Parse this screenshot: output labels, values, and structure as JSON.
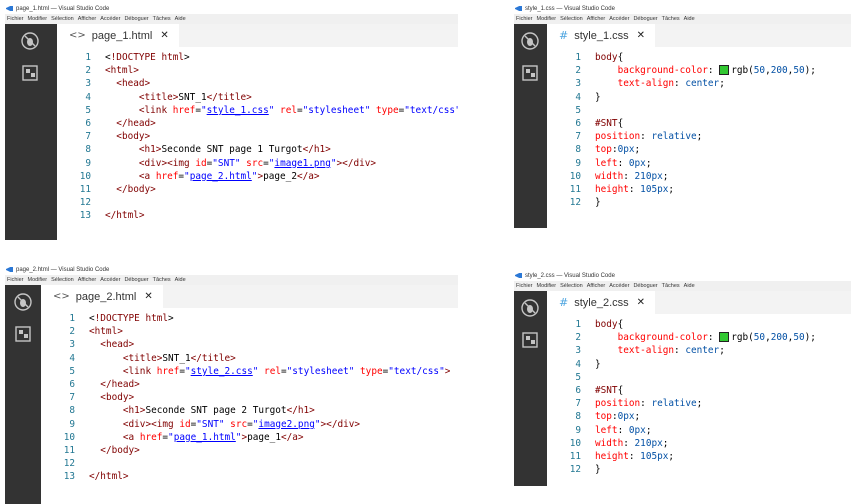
{
  "menu": [
    "Fichier",
    "Modifier",
    "Sélection",
    "Afficher",
    "Accéder",
    "Déboguer",
    "Tâches",
    "Aide"
  ],
  "windows": [
    {
      "id": "w1",
      "title": "page_1.html — Visual Studio Code",
      "tab": "page_1.html",
      "lines": [
        [
          {
            "c": "pun",
            "t": "<"
          },
          {
            "c": "tag",
            "t": "!DOCTYPE html"
          },
          {
            "c": "pun",
            "t": ">"
          }
        ],
        [
          {
            "c": "tag",
            "t": "<html>"
          }
        ],
        [
          {
            "c": "txt",
            "t": "  "
          },
          {
            "c": "tag",
            "t": "<head>"
          }
        ],
        [
          {
            "c": "txt",
            "t": "      "
          },
          {
            "c": "tag",
            "t": "<title>"
          },
          {
            "c": "txt",
            "t": "SNT_1"
          },
          {
            "c": "tag",
            "t": "</title>"
          }
        ],
        [
          {
            "c": "txt",
            "t": "      "
          },
          {
            "c": "tag",
            "t": "<link "
          },
          {
            "c": "attr",
            "t": "href"
          },
          {
            "c": "pun",
            "t": "="
          },
          {
            "c": "str",
            "t": "\""
          },
          {
            "c": "lnk",
            "t": "style_1.css"
          },
          {
            "c": "str",
            "t": "\""
          },
          {
            "c": "txt",
            "t": " "
          },
          {
            "c": "attr",
            "t": "rel"
          },
          {
            "c": "pun",
            "t": "="
          },
          {
            "c": "str",
            "t": "\"stylesheet\""
          },
          {
            "c": "txt",
            "t": " "
          },
          {
            "c": "attr",
            "t": "type"
          },
          {
            "c": "pun",
            "t": "="
          },
          {
            "c": "str",
            "t": "\"text/css\""
          },
          {
            "c": "tag",
            "t": ">"
          }
        ],
        [
          {
            "c": "txt",
            "t": "  "
          },
          {
            "c": "tag",
            "t": "</head>"
          }
        ],
        [
          {
            "c": "txt",
            "t": "  "
          },
          {
            "c": "tag",
            "t": "<body>"
          }
        ],
        [
          {
            "c": "txt",
            "t": "      "
          },
          {
            "c": "tag",
            "t": "<h1>"
          },
          {
            "c": "txt",
            "t": "Seconde SNT page 1 Turgot"
          },
          {
            "c": "tag",
            "t": "</h1>"
          }
        ],
        [
          {
            "c": "txt",
            "t": "      "
          },
          {
            "c": "tag",
            "t": "<div><img "
          },
          {
            "c": "attr",
            "t": "id"
          },
          {
            "c": "pun",
            "t": "="
          },
          {
            "c": "str",
            "t": "\"SNT\""
          },
          {
            "c": "txt",
            "t": " "
          },
          {
            "c": "attr",
            "t": "src"
          },
          {
            "c": "pun",
            "t": "="
          },
          {
            "c": "str",
            "t": "\""
          },
          {
            "c": "lnk",
            "t": "image1.png"
          },
          {
            "c": "str",
            "t": "\""
          },
          {
            "c": "tag",
            "t": "></div>"
          }
        ],
        [
          {
            "c": "txt",
            "t": "      "
          },
          {
            "c": "tag",
            "t": "<a "
          },
          {
            "c": "attr",
            "t": "href"
          },
          {
            "c": "pun",
            "t": "="
          },
          {
            "c": "str",
            "t": "\""
          },
          {
            "c": "lnk",
            "t": "page_2.html"
          },
          {
            "c": "str",
            "t": "\""
          },
          {
            "c": "tag",
            "t": ">"
          },
          {
            "c": "txt",
            "t": "page_2"
          },
          {
            "c": "tag",
            "t": "</a>"
          }
        ],
        [
          {
            "c": "txt",
            "t": "  "
          },
          {
            "c": "tag",
            "t": "</body>"
          }
        ],
        [],
        [
          {
            "c": "tag",
            "t": "</html>"
          }
        ]
      ]
    },
    {
      "id": "w2",
      "title": "style_1.css — Visual Studio Code",
      "tab": "style_1.css",
      "lines": [
        [
          {
            "c": "sel",
            "t": "body"
          },
          {
            "c": "pun",
            "t": "{"
          }
        ],
        [
          {
            "c": "txt",
            "t": "    "
          },
          {
            "c": "prop",
            "t": "background-color"
          },
          {
            "c": "pun",
            "t": ": "
          },
          {
            "c": "swatch",
            "t": ""
          },
          {
            "c": "pun",
            "t": "rgb("
          },
          {
            "c": "val",
            "t": "50"
          },
          {
            "c": "pun",
            "t": ","
          },
          {
            "c": "val",
            "t": "200"
          },
          {
            "c": "pun",
            "t": ","
          },
          {
            "c": "val",
            "t": "50"
          },
          {
            "c": "pun",
            "t": ");"
          }
        ],
        [
          {
            "c": "txt",
            "t": "    "
          },
          {
            "c": "prop",
            "t": "text-align"
          },
          {
            "c": "pun",
            "t": ": "
          },
          {
            "c": "val",
            "t": "center"
          },
          {
            "c": "pun",
            "t": ";"
          }
        ],
        [
          {
            "c": "pun",
            "t": "}"
          }
        ],
        [],
        [
          {
            "c": "sel",
            "t": "#SNT"
          },
          {
            "c": "pun",
            "t": "{"
          }
        ],
        [
          {
            "c": "prop",
            "t": "position"
          },
          {
            "c": "pun",
            "t": ": "
          },
          {
            "c": "val",
            "t": "relative"
          },
          {
            "c": "pun",
            "t": ";"
          }
        ],
        [
          {
            "c": "prop",
            "t": "top"
          },
          {
            "c": "pun",
            "t": ":"
          },
          {
            "c": "val",
            "t": "0px"
          },
          {
            "c": "pun",
            "t": ";"
          }
        ],
        [
          {
            "c": "prop",
            "t": "left"
          },
          {
            "c": "pun",
            "t": ": "
          },
          {
            "c": "val",
            "t": "0px"
          },
          {
            "c": "pun",
            "t": ";"
          }
        ],
        [
          {
            "c": "prop",
            "t": "width"
          },
          {
            "c": "pun",
            "t": ": "
          },
          {
            "c": "val",
            "t": "210px"
          },
          {
            "c": "pun",
            "t": ";"
          }
        ],
        [
          {
            "c": "prop",
            "t": "height"
          },
          {
            "c": "pun",
            "t": ": "
          },
          {
            "c": "val",
            "t": "105px"
          },
          {
            "c": "pun",
            "t": ";"
          }
        ],
        [
          {
            "c": "pun",
            "t": "}"
          }
        ]
      ]
    },
    {
      "id": "w3",
      "title": "page_2.html — Visual Studio Code",
      "tab": "page_2.html",
      "lines": [
        [
          {
            "c": "pun",
            "t": "<"
          },
          {
            "c": "tag",
            "t": "!DOCTYPE html"
          },
          {
            "c": "pun",
            "t": ">"
          }
        ],
        [
          {
            "c": "tag",
            "t": "<html>"
          }
        ],
        [
          {
            "c": "txt",
            "t": "  "
          },
          {
            "c": "tag",
            "t": "<head>"
          }
        ],
        [
          {
            "c": "txt",
            "t": "      "
          },
          {
            "c": "tag",
            "t": "<title>"
          },
          {
            "c": "txt",
            "t": "SNT_1"
          },
          {
            "c": "tag",
            "t": "</title>"
          }
        ],
        [
          {
            "c": "txt",
            "t": "      "
          },
          {
            "c": "tag",
            "t": "<link "
          },
          {
            "c": "attr",
            "t": "href"
          },
          {
            "c": "pun",
            "t": "="
          },
          {
            "c": "str",
            "t": "\""
          },
          {
            "c": "lnk",
            "t": "style_2.css"
          },
          {
            "c": "str",
            "t": "\""
          },
          {
            "c": "txt",
            "t": " "
          },
          {
            "c": "attr",
            "t": "rel"
          },
          {
            "c": "pun",
            "t": "="
          },
          {
            "c": "str",
            "t": "\"stylesheet\""
          },
          {
            "c": "txt",
            "t": " "
          },
          {
            "c": "attr",
            "t": "type"
          },
          {
            "c": "pun",
            "t": "="
          },
          {
            "c": "str",
            "t": "\"text/css\""
          },
          {
            "c": "tag",
            "t": ">"
          }
        ],
        [
          {
            "c": "txt",
            "t": "  "
          },
          {
            "c": "tag",
            "t": "</head>"
          }
        ],
        [
          {
            "c": "txt",
            "t": "  "
          },
          {
            "c": "tag",
            "t": "<body>"
          }
        ],
        [
          {
            "c": "txt",
            "t": "      "
          },
          {
            "c": "tag",
            "t": "<h1>"
          },
          {
            "c": "txt",
            "t": "Seconde SNT page 2 Turgot"
          },
          {
            "c": "tag",
            "t": "</h1>"
          }
        ],
        [
          {
            "c": "txt",
            "t": "      "
          },
          {
            "c": "tag",
            "t": "<div><img "
          },
          {
            "c": "attr",
            "t": "id"
          },
          {
            "c": "pun",
            "t": "="
          },
          {
            "c": "str",
            "t": "\"SNT\""
          },
          {
            "c": "txt",
            "t": " "
          },
          {
            "c": "attr",
            "t": "src"
          },
          {
            "c": "pun",
            "t": "="
          },
          {
            "c": "str",
            "t": "\""
          },
          {
            "c": "lnk",
            "t": "image2.png"
          },
          {
            "c": "str",
            "t": "\""
          },
          {
            "c": "tag",
            "t": "></div>"
          }
        ],
        [
          {
            "c": "txt",
            "t": "      "
          },
          {
            "c": "tag",
            "t": "<a "
          },
          {
            "c": "attr",
            "t": "href"
          },
          {
            "c": "pun",
            "t": "="
          },
          {
            "c": "str",
            "t": "\""
          },
          {
            "c": "lnk",
            "t": "page_1.html"
          },
          {
            "c": "str",
            "t": "\""
          },
          {
            "c": "tag",
            "t": ">"
          },
          {
            "c": "txt",
            "t": "page_1"
          },
          {
            "c": "tag",
            "t": "</a>"
          }
        ],
        [
          {
            "c": "txt",
            "t": "  "
          },
          {
            "c": "tag",
            "t": "</body>"
          }
        ],
        [],
        [
          {
            "c": "tag",
            "t": "</html>"
          }
        ]
      ]
    },
    {
      "id": "w4",
      "title": "style_2.css — Visual Studio Code",
      "tab": "style_2.css",
      "lines": [
        [
          {
            "c": "sel",
            "t": "body"
          },
          {
            "c": "pun",
            "t": "{"
          }
        ],
        [
          {
            "c": "txt",
            "t": "    "
          },
          {
            "c": "prop",
            "t": "background-color"
          },
          {
            "c": "pun",
            "t": ": "
          },
          {
            "c": "swatch",
            "t": ""
          },
          {
            "c": "pun",
            "t": "rgb("
          },
          {
            "c": "val",
            "t": "50"
          },
          {
            "c": "pun",
            "t": ","
          },
          {
            "c": "val",
            "t": "200"
          },
          {
            "c": "pun",
            "t": ","
          },
          {
            "c": "val",
            "t": "50"
          },
          {
            "c": "pun",
            "t": ");"
          }
        ],
        [
          {
            "c": "txt",
            "t": "    "
          },
          {
            "c": "prop",
            "t": "text-align"
          },
          {
            "c": "pun",
            "t": ": "
          },
          {
            "c": "val",
            "t": "center"
          },
          {
            "c": "pun",
            "t": ";"
          }
        ],
        [
          {
            "c": "pun",
            "t": "}"
          }
        ],
        [],
        [
          {
            "c": "sel",
            "t": "#SNT"
          },
          {
            "c": "pun",
            "t": "{"
          }
        ],
        [
          {
            "c": "prop",
            "t": "position"
          },
          {
            "c": "pun",
            "t": ": "
          },
          {
            "c": "val",
            "t": "relative"
          },
          {
            "c": "pun",
            "t": ";"
          }
        ],
        [
          {
            "c": "prop",
            "t": "top"
          },
          {
            "c": "pun",
            "t": ":"
          },
          {
            "c": "val",
            "t": "0px"
          },
          {
            "c": "pun",
            "t": ";"
          }
        ],
        [
          {
            "c": "prop",
            "t": "left"
          },
          {
            "c": "pun",
            "t": ": "
          },
          {
            "c": "val",
            "t": "0px"
          },
          {
            "c": "pun",
            "t": ";"
          }
        ],
        [
          {
            "c": "prop",
            "t": "width"
          },
          {
            "c": "pun",
            "t": ": "
          },
          {
            "c": "val",
            "t": "210px"
          },
          {
            "c": "pun",
            "t": ";"
          }
        ],
        [
          {
            "c": "prop",
            "t": "height"
          },
          {
            "c": "pun",
            "t": ": "
          },
          {
            "c": "val",
            "t": "105px"
          },
          {
            "c": "pun",
            "t": ";"
          }
        ],
        [
          {
            "c": "pun",
            "t": "}"
          }
        ]
      ]
    }
  ]
}
